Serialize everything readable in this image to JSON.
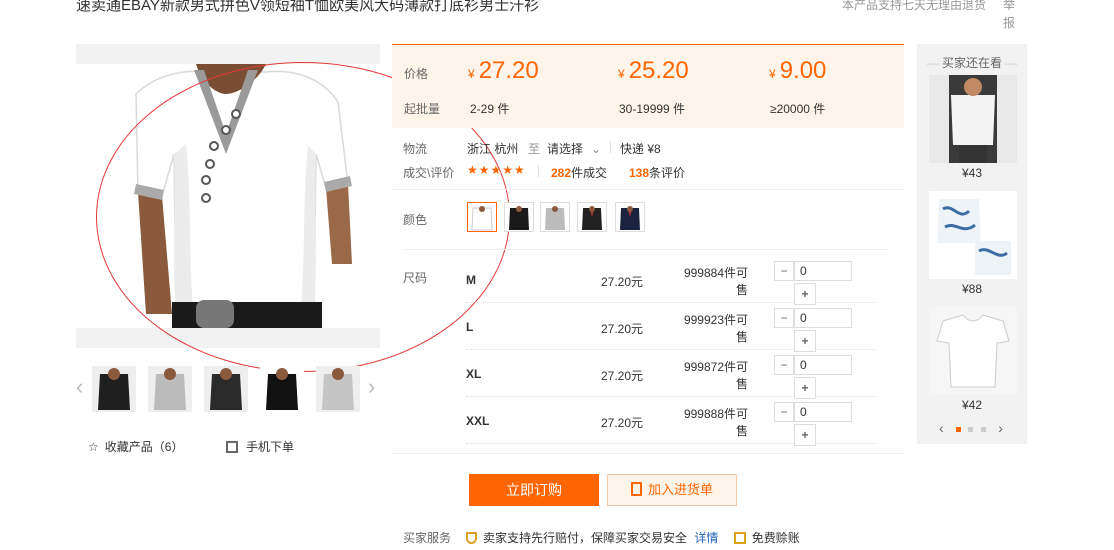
{
  "product": {
    "title": "速卖通EBAY新款男式拼色V领短袖T恤欧美风大码薄款打底衫男士汗衫",
    "return_note": "本产品支持七天无理由退货",
    "report": "举报"
  },
  "gallery": {
    "main_image_alt": "white-vneck-tshirt",
    "thumbnails_count": 5
  },
  "actions_left": {
    "favorite_label": "收藏产品（6）",
    "mobile_order_label": "手机下单"
  },
  "pricing": {
    "price_label": "价格",
    "moq_label": "起批量",
    "currency": "¥",
    "tiers": [
      {
        "price": "27.20",
        "range": "2-29 件"
      },
      {
        "price": "25.20",
        "range": "30-19999 件"
      },
      {
        "price": "9.00",
        "range": "≥20000 件"
      }
    ]
  },
  "logistics": {
    "label": "物流",
    "origin": "浙江 杭州",
    "to": "至",
    "destination": "请选择",
    "express": "快递 ¥8"
  },
  "reviews": {
    "label": "成交\\评价",
    "stars": "★★★★★",
    "deals_count": "282",
    "deals_label": "件成交",
    "review_count": "138",
    "review_label": "条评价"
  },
  "color": {
    "label": "颜色",
    "options": [
      "white",
      "black",
      "gray",
      "black-red",
      "navy"
    ]
  },
  "size": {
    "label": "尺码",
    "rows": [
      {
        "name": "M",
        "price": "27.20元",
        "stock": "999884件可售",
        "qty": "0"
      },
      {
        "name": "L",
        "price": "27.20元",
        "stock": "999923件可售",
        "qty": "0"
      },
      {
        "name": "XL",
        "price": "27.20元",
        "stock": "999872件可售",
        "qty": "0"
      },
      {
        "name": "XXL",
        "price": "27.20元",
        "stock": "999888件可售",
        "qty": "0"
      }
    ],
    "minus": "−",
    "plus": "+"
  },
  "buttons": {
    "buy_now": "立即订购",
    "add_to_cart": "加入进货单"
  },
  "service": {
    "label": "买家服务",
    "text": "卖家支持先行赔付，保障买家交易安全",
    "details": "详情",
    "free_shipping": "免费赊账"
  },
  "sidebar": {
    "title": "买家还在看",
    "items": [
      {
        "price": "¥43"
      },
      {
        "price": "¥88"
      },
      {
        "price": "¥42"
      }
    ],
    "prev": "‹",
    "next": "›"
  },
  "colors": {
    "accent": "#ff6600",
    "price_bg": "#fff4ea",
    "link": "#2266bb"
  }
}
